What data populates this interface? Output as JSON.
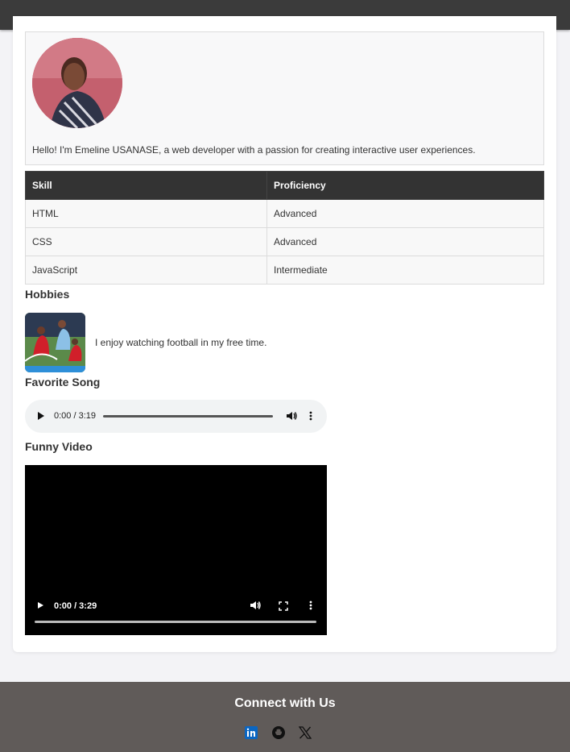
{
  "profile": {
    "bio": "Hello! I'm Emeline USANASE, a web developer with a passion for creating interactive user experiences."
  },
  "skills": {
    "headers": [
      "Skill",
      "Proficiency"
    ],
    "rows": [
      [
        "HTML",
        "Advanced"
      ],
      [
        "CSS",
        "Advanced"
      ],
      [
        "JavaScript",
        "Intermediate"
      ]
    ]
  },
  "hobbies": {
    "heading": "Hobbies",
    "text": "I enjoy watching football in my free time."
  },
  "song": {
    "heading": "Favorite Song",
    "time": "0:00 / 3:19"
  },
  "video": {
    "heading": "Funny Video",
    "time": "0:00 / 3:29"
  },
  "footer": {
    "title": "Connect with Us",
    "icons": [
      "linkedin-icon",
      "github-icon",
      "x-icon"
    ]
  },
  "colors": {
    "topbar": "#3b3b3b",
    "table_header": "#333333",
    "footer": "#605b59",
    "linkedin": "#0a66c2"
  }
}
